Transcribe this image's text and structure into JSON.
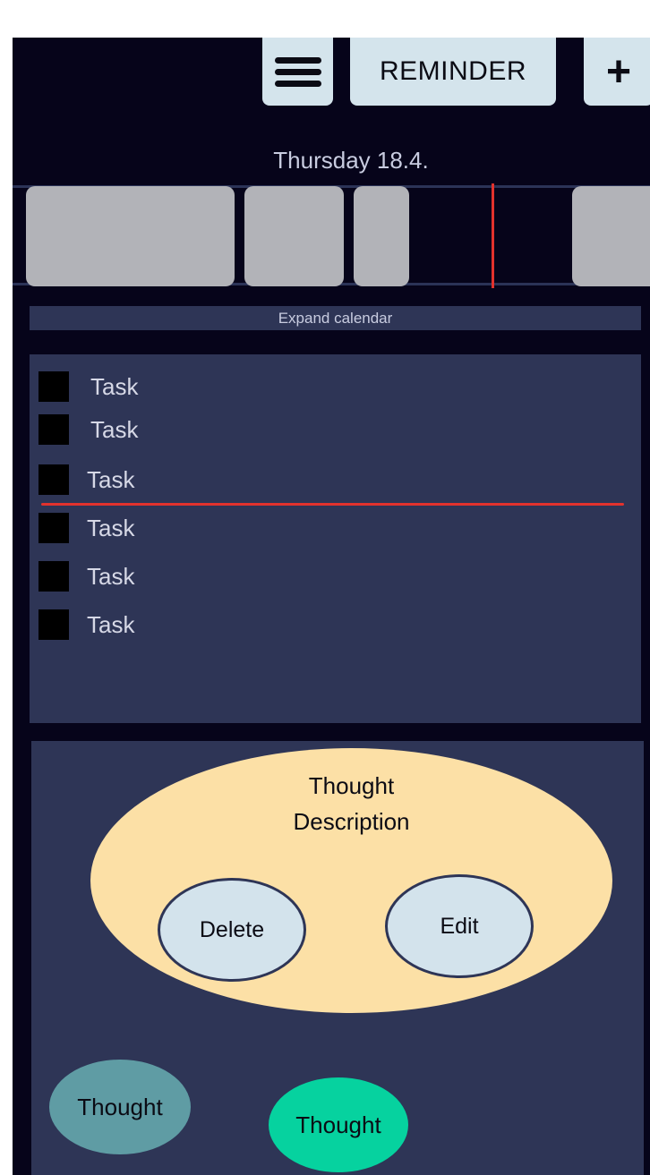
{
  "header": {
    "menu_icon": "hamburger-menu-icon",
    "reminder_label": "REMINDER",
    "add_label": "+"
  },
  "calendar": {
    "date_label": "Thursday 18.4.",
    "expand_label": "Expand calendar"
  },
  "tasks": [
    {
      "label": "Task"
    },
    {
      "label": "Task"
    },
    {
      "label": "Task"
    },
    {
      "label": "Task"
    },
    {
      "label": "Task"
    },
    {
      "label": "Task"
    }
  ],
  "thoughts": {
    "selected": {
      "title": "Thought",
      "description": "Description",
      "delete_label": "Delete",
      "edit_label": "Edit"
    },
    "items": [
      {
        "label": "Thought",
        "color": "#5f9ca4"
      },
      {
        "label": "Thought",
        "color": "#06d29f"
      }
    ]
  },
  "colors": {
    "background": "#06041a",
    "panel": "#2e3556",
    "button": "#d4e4ec",
    "highlight": "#e2322d",
    "thought_bubble": "#fce0a6",
    "calendar_block": "#b2b3b8"
  }
}
